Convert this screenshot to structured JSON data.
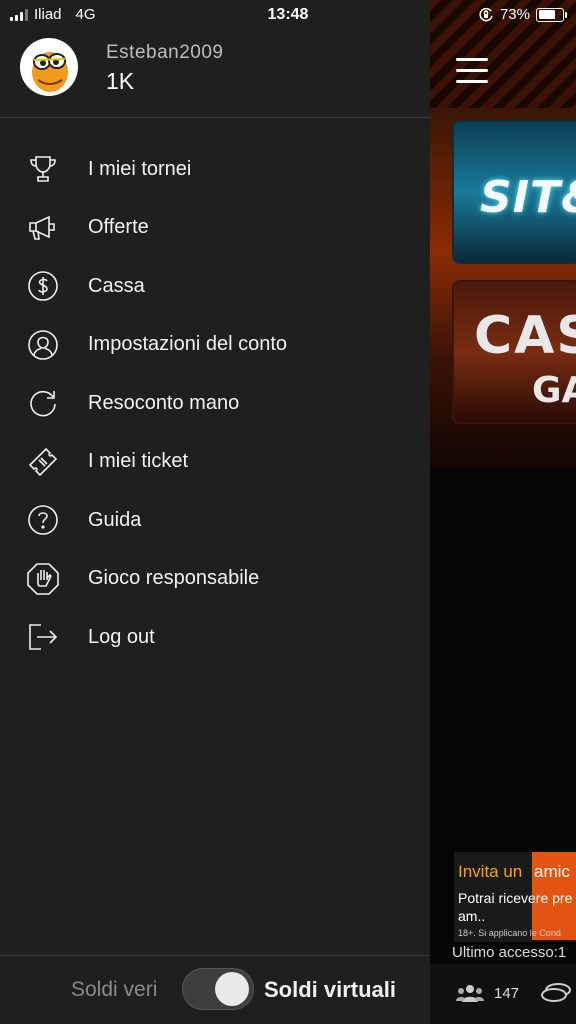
{
  "status_bar": {
    "carrier": "Iliad",
    "network": "4G",
    "time": "13:48",
    "battery": "73%",
    "battery_level": 0.73
  },
  "profile": {
    "username": "Esteban2009",
    "balance": "1K"
  },
  "menu": [
    {
      "label": "I miei tornei",
      "icon": "trophy-icon"
    },
    {
      "label": "Offerte",
      "icon": "megaphone-icon"
    },
    {
      "label": "Cassa",
      "icon": "dollar-circle-icon"
    },
    {
      "label": "Impostazioni del conto",
      "icon": "user-circle-icon"
    },
    {
      "label": "Resoconto mano",
      "icon": "refresh-icon"
    },
    {
      "label": "I miei ticket",
      "icon": "ticket-icon"
    },
    {
      "label": "Guida",
      "icon": "help-circle-icon"
    },
    {
      "label": "Gioco responsabile",
      "icon": "stop-hand-icon"
    },
    {
      "label": "Log out",
      "icon": "logout-icon"
    }
  ],
  "footer": {
    "real_money_label": "Soldi veri",
    "virtual_money_label": "Soldi virtuali",
    "toggle_state": "virtual"
  },
  "background_app": {
    "banner_sit_text": "SIT&",
    "banner_cash_text_1": "CAS",
    "banner_cash_text_2": "GA",
    "invite_title_1": "Invita un ",
    "invite_title_2": "amic",
    "invite_body": "Potrai ricevere pre i tuoi am..",
    "invite_legal": "18+. Si applicano le Cond",
    "last_access": "Ultimo accesso:1",
    "players_count": "147"
  },
  "colors": {
    "drawer_bg": "#1f1f1f",
    "accent_orange": "#e25410",
    "invite_yellow": "#f7a600"
  }
}
